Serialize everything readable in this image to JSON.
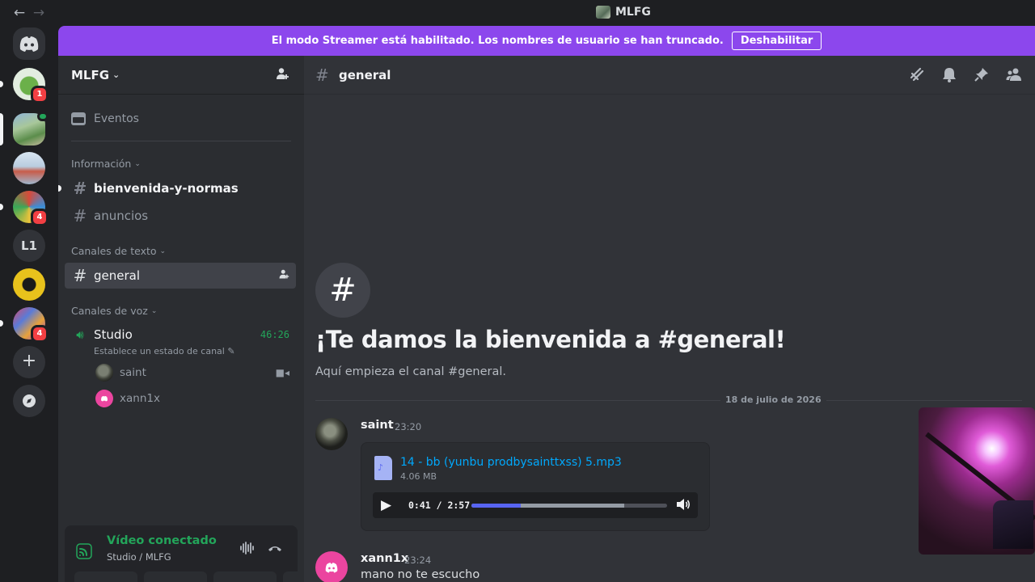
{
  "titlebar": {
    "back_icon": "arrow-left-icon",
    "forward_icon": "arrow-right-icon",
    "title": "MLFG"
  },
  "rail": {
    "home_icon": "discord-logo-icon",
    "servers": [
      {
        "name": "turtle-server",
        "badge": "1"
      },
      {
        "name": "minecraft-server",
        "badge": ""
      },
      {
        "name": "snow-server",
        "badge": ""
      },
      {
        "name": "gta-server",
        "badge": "4"
      },
      {
        "name": "L1",
        "label": "L1",
        "badge": ""
      },
      {
        "name": "yellow-server",
        "badge": ""
      },
      {
        "name": "gta-collage-server",
        "badge": "4"
      }
    ],
    "add_icon": "plus-icon",
    "discover_icon": "compass-icon"
  },
  "banner": {
    "text": "El modo Streamer está habilitado. Los nombres de usuario se han truncado.",
    "button": "Deshabilitar",
    "color": "#8c47ed"
  },
  "sidebar": {
    "server_name": "MLFG",
    "events_label": "Eventos",
    "categories": {
      "info": "Información",
      "text": "Canales de texto",
      "voice": "Canales de voz"
    },
    "channels": {
      "welcome": "bienvenida-y-normas",
      "announcements": "anuncios",
      "general": "general"
    },
    "voice_channel": {
      "name": "Studio",
      "timer": "46:26",
      "status_placeholder": "Establece un estado de canal",
      "members": [
        "saint",
        "xann1x"
      ]
    },
    "voice_panel": {
      "title": "Vídeo conectado",
      "subtitle": "Studio / MLFG"
    }
  },
  "main": {
    "channel_name": "general",
    "welcome_title": "¡Te damos la bienvenida a #general!",
    "welcome_sub": "Aquí empieza el canal #general.",
    "date_divider": "18 de julio de 2026",
    "messages": [
      {
        "author": "saint",
        "time": "23:20",
        "attachment": {
          "file_name": "14 - bb (yunbu prodbysainttxss) 5.mp3",
          "size": "4.06 MB",
          "time_display": "0:41 / 2:57",
          "progress": 0.25,
          "buffered": 0.78
        }
      },
      {
        "author": "xann1x",
        "time": "23:24",
        "text": "mano no te escucho"
      }
    ]
  }
}
